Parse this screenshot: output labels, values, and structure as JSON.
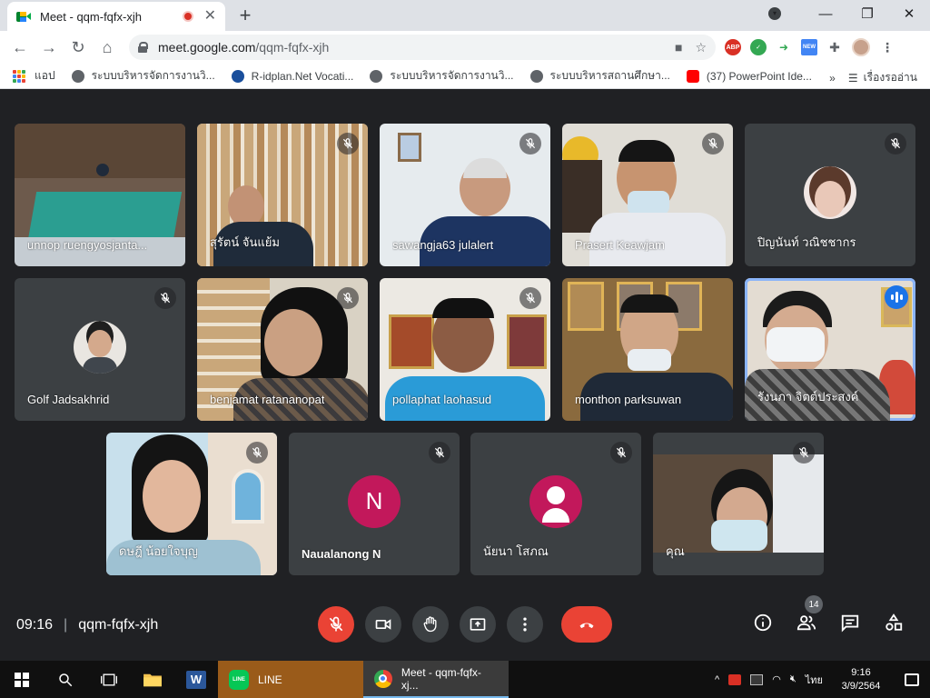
{
  "browser": {
    "tab_title": "Meet - qqm-fqfx-xjh",
    "url_host": "meet.google.com",
    "url_path": "/qqm-fqfx-xjh",
    "ext_abp": "ABP",
    "ext_new": "NEW"
  },
  "bookmarks": {
    "apps_label": "แอป",
    "items": [
      {
        "label": "ระบบบริหารจัดการงานวิ..."
      },
      {
        "label": "R-idplan.Net Vocati..."
      },
      {
        "label": "ระบบบริหารจัดการงานวิ..."
      },
      {
        "label": "ระบบบริหารสถานศึกษา..."
      },
      {
        "label": "(37) PowerPoint Ide..."
      }
    ],
    "overflow": "»",
    "reading_list": "เรื่องรออ่าน"
  },
  "participants": [
    {
      "name": "unnop ruengyosjanta...",
      "kind": "video"
    },
    {
      "name": "สุรัตน์ จันแย้ม",
      "kind": "video"
    },
    {
      "name": "sawangja63 julalert",
      "kind": "video"
    },
    {
      "name": "Prasert Keawjam",
      "kind": "video"
    },
    {
      "name": "ปิญนันท์ วณิชชากร",
      "kind": "avatar"
    },
    {
      "name": "Golf Jadsakhrid",
      "kind": "avatar"
    },
    {
      "name": "benjamat ratananopat",
      "kind": "video"
    },
    {
      "name": "pollaphat laohasud",
      "kind": "video"
    },
    {
      "name": "monthon parksuwan",
      "kind": "video"
    },
    {
      "name": "รังนภา จิตต์ประสงค์",
      "kind": "video",
      "speaking": true
    },
    {
      "name": "ดษฎี น้อยใจบุญ",
      "kind": "video"
    },
    {
      "name": "Naualanong N",
      "kind": "letter",
      "letter": "N"
    },
    {
      "name": "นัยนา โสภณ",
      "kind": "default-avatar"
    },
    {
      "name": "คุณ",
      "kind": "video"
    }
  ],
  "meeting": {
    "time": "09:16",
    "separator": "|",
    "code": "qqm-fqfx-xjh",
    "people_count": "14"
  },
  "taskbar": {
    "line_label": "LINE",
    "line_icon_text": "LINE",
    "chrome_label": "Meet - qqm-fqfx-xj...",
    "word_icon_text": "W",
    "lang": "ไทย",
    "clock_time": "9:16",
    "clock_date": "3/9/2564"
  },
  "colors": {
    "speaking_outline": "#8ab4f8",
    "end_call": "#ea4335",
    "letter_avatar": "#c2185b",
    "default_avatar": "#c2185b"
  }
}
